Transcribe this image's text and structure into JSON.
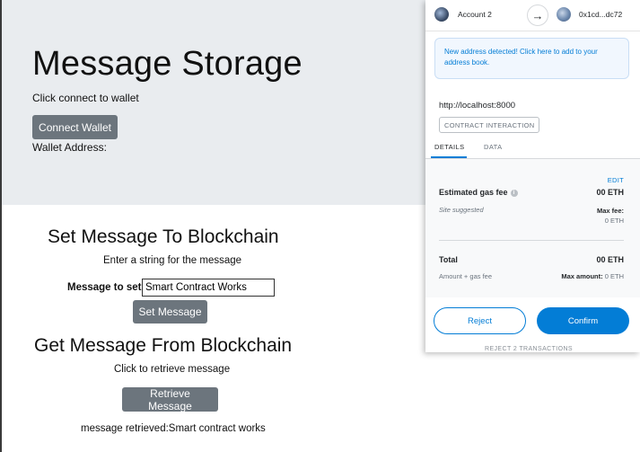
{
  "app": {
    "title": "Message Storage",
    "subtitle": "Click connect to wallet",
    "connect_label": "Connect Wallet",
    "wallet_address_label": "Wallet Address:"
  },
  "set_section": {
    "title": "Set Message To Blockchain",
    "subtitle": "Enter a string for the message",
    "input_label": "Message to set",
    "input_value": "Smart Contract Works",
    "button_label": "Set Message"
  },
  "get_section": {
    "title": "Get Message From Blockchain",
    "subtitle": "Click to retrieve message",
    "button_label": "Retrieve Message",
    "result_text": "message retrieved:Smart contract works"
  },
  "wallet_popup": {
    "account_name": "Account 2",
    "recipient_address": "0x1cd...dc72",
    "notice": "New address detected! Click here to add to your address book.",
    "origin": "http://localhost:8000",
    "badge": "CONTRACT INTERACTION",
    "tabs": [
      "DETAILS",
      "DATA"
    ],
    "edit_label": "EDIT",
    "gas_label": "Estimated gas fee",
    "gas_value": "00 ETH",
    "site_suggested": "Site suggested",
    "max_fee_label": "Max fee:",
    "max_fee_value": "0 ETH",
    "total_label": "Total",
    "total_value": "00 ETH",
    "amount_gas_label": "Amount + gas fee",
    "max_amount_label": "Max amount:",
    "max_amount_value": "0 ETH",
    "reject_label": "Reject",
    "confirm_label": "Confirm",
    "cut_off_text": "REJECT 2 TRANSACTIONS"
  },
  "colors": {
    "hero_bg": "#e9ecef",
    "button_gray": "#6c757d",
    "metamask_blue": "#037dd6"
  }
}
